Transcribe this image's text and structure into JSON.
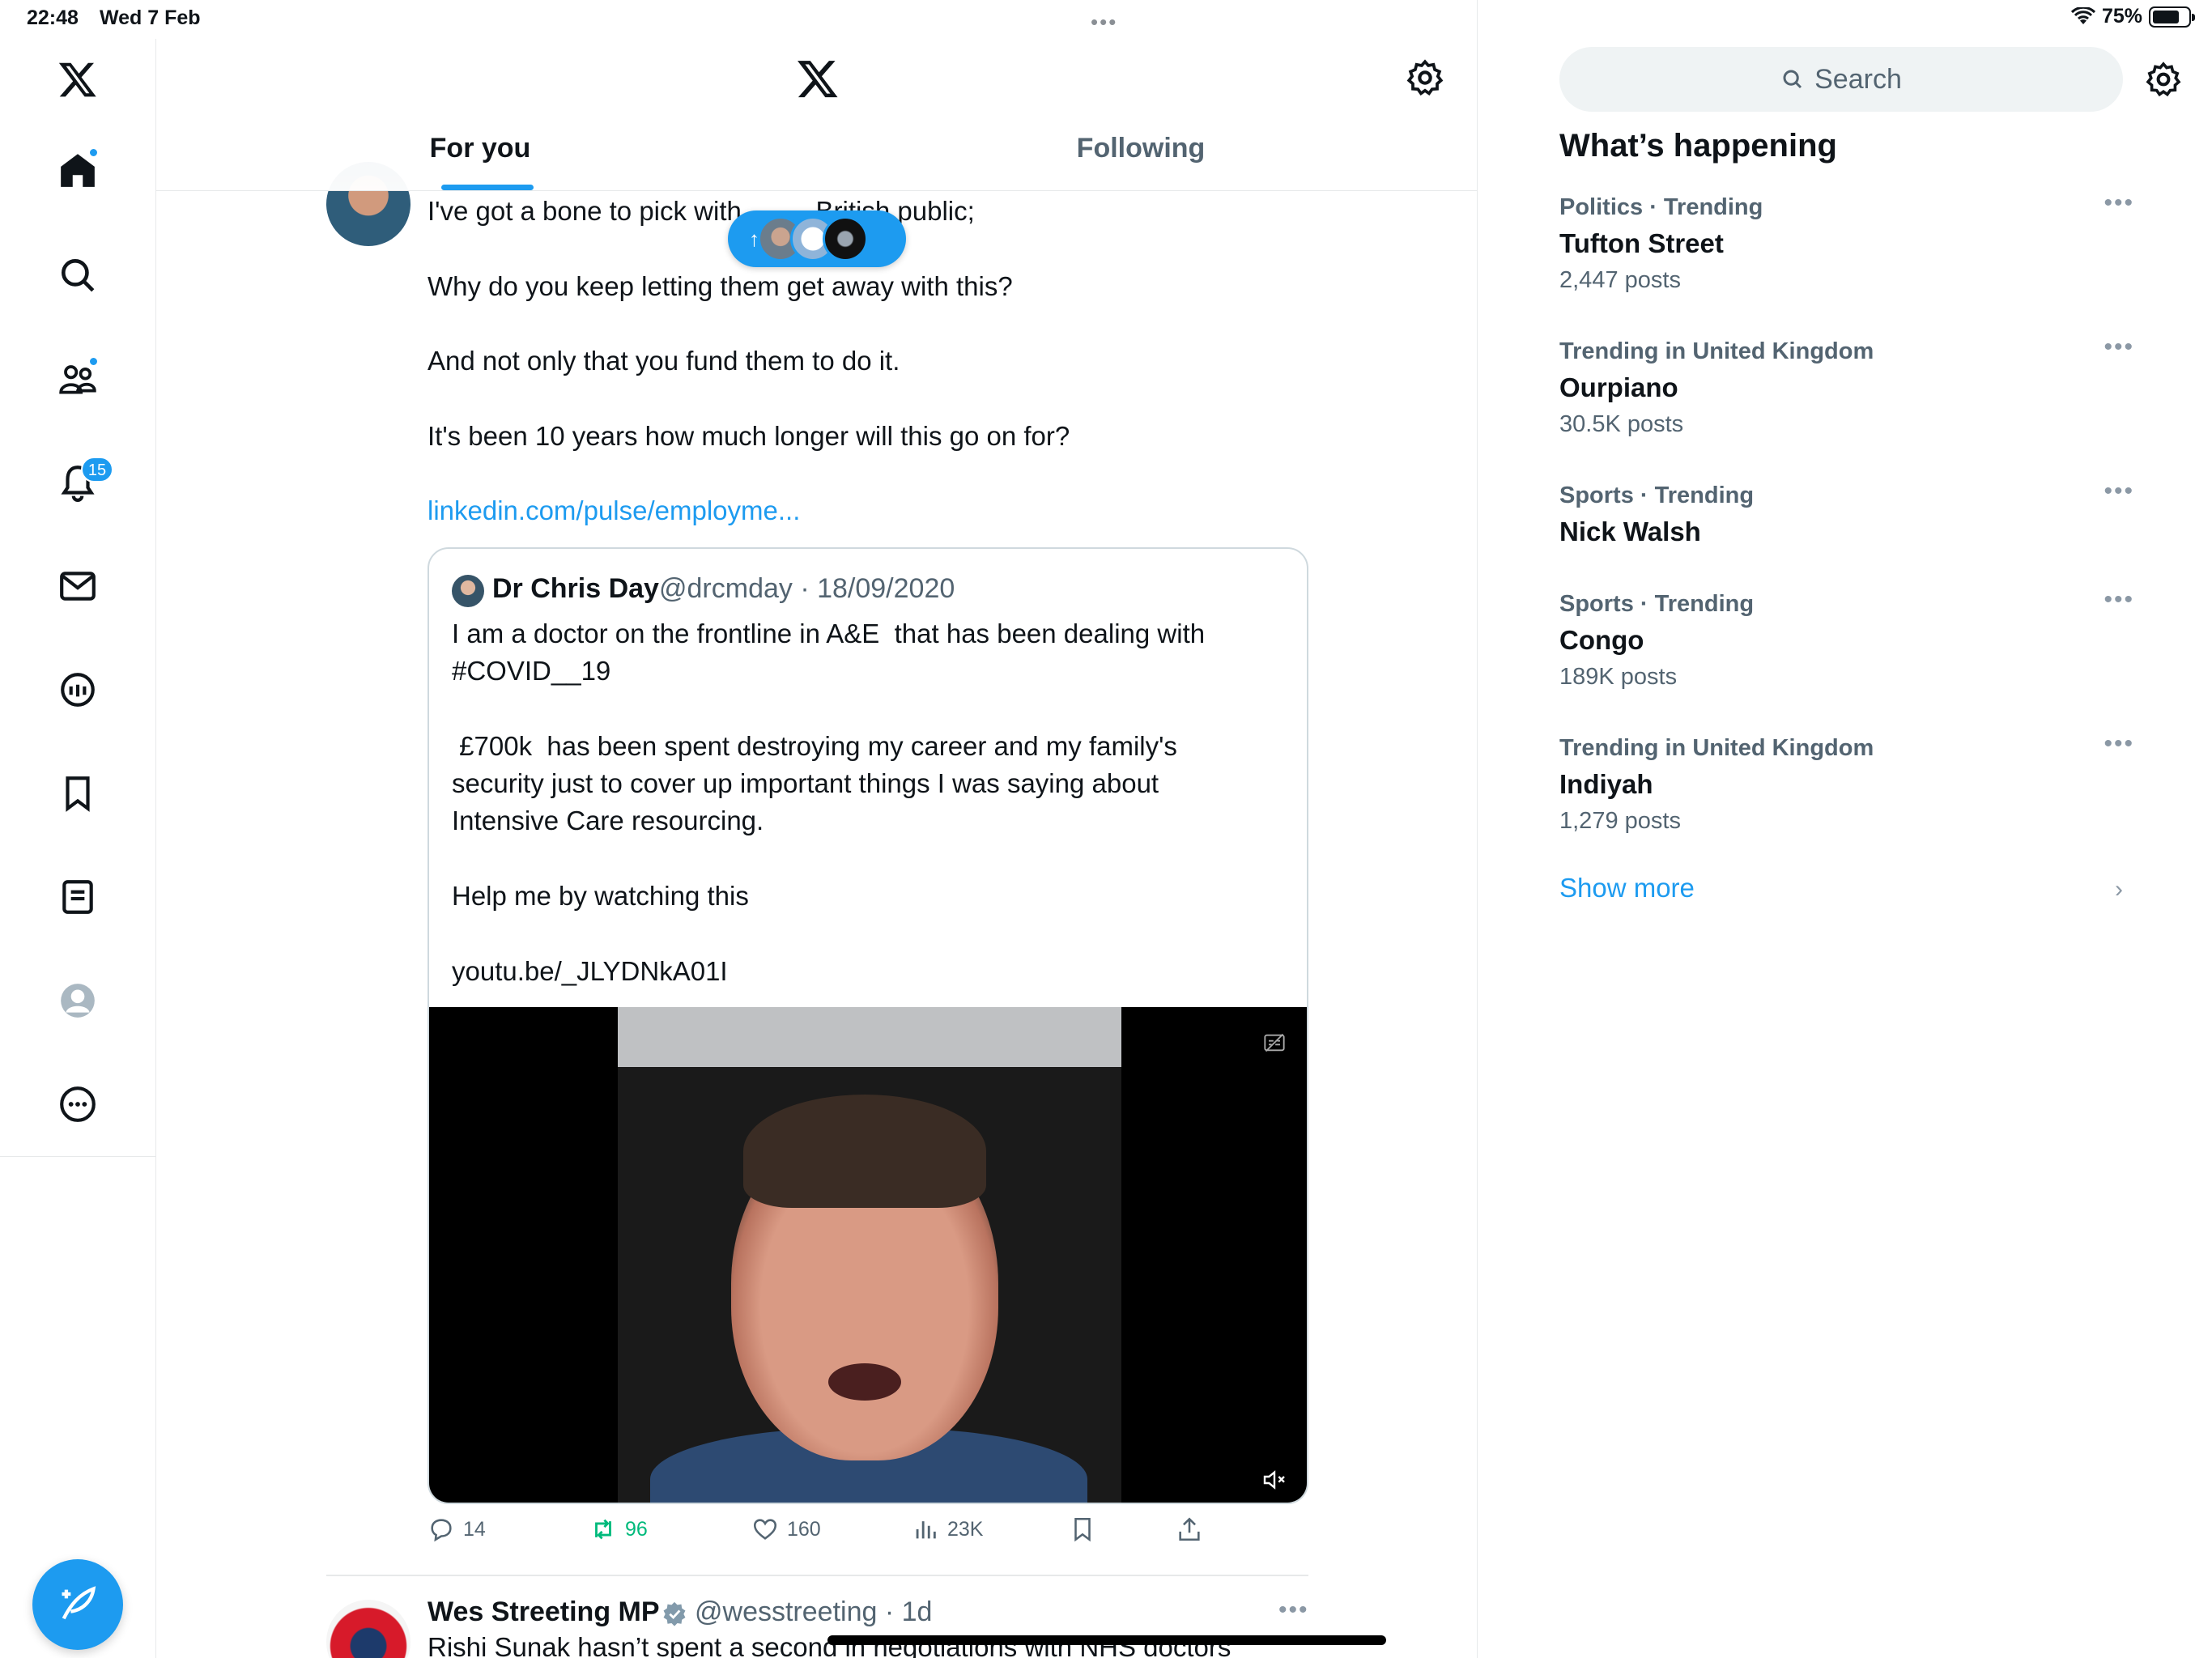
{
  "status_bar": {
    "time": "22:48",
    "date": "Wed 7 Feb",
    "dots": "•••",
    "battery": "75%"
  },
  "header": {
    "tabs": [
      {
        "label": "For you"
      },
      {
        "label": "Following"
      }
    ]
  },
  "left_nav": {
    "notifications_badge": "15",
    "icons": [
      "x-logo-icon",
      "home-icon",
      "search-icon",
      "communities-icon",
      "notifications-icon",
      "messages-icon",
      "grok-icon",
      "bookmarks-icon",
      "lists-icon",
      "profile-icon",
      "more-icon",
      "compose-icon"
    ]
  },
  "new_posts_pill": {
    "arrow": "↑"
  },
  "tweet": {
    "lines": [
      "I've got a bone to pick with          British public;",
      "Why do you keep letting them get away with this?",
      "And not only that you fund them to do it.",
      "It's been 10 years how much longer will this go on for?"
    ],
    "link": "linkedin.com/pulse/employme...",
    "quote": {
      "name": "Dr Chris Day",
      "handle_date": "@drcmday · 18/09/2020",
      "lines": [
        "I am a doctor on the frontline in A&E  that has been dealing with",
        "#COVID__19",
        " £700k  has been spent destroying my career and my family's",
        "security just to cover up important things I was saying about",
        "Intensive Care resourcing.",
        "Help me by watching this",
        "youtu.be/_JLYDNkA01I"
      ]
    },
    "actions": {
      "replies": "14",
      "retweets": "96",
      "likes": "160",
      "views": "23K"
    }
  },
  "next_tweet": {
    "name": "Wes Streeting MP",
    "handle_date": "@wesstreeting · 1d",
    "text": "Rishi Sunak hasn’t spent a second in negotiations with NHS doctors",
    "more": "•••"
  },
  "right": {
    "search_placeholder": "Search",
    "section_title": "What’s happening",
    "trends": [
      {
        "meta": "Politics · Trending",
        "title": "Tufton Street",
        "count": "2,447 posts"
      },
      {
        "meta": "Trending in United Kingdom",
        "title": "Ourpiano",
        "count": "30.5K posts"
      },
      {
        "meta": "Sports · Trending",
        "title": "Nick Walsh",
        "count": ""
      },
      {
        "meta": "Sports · Trending",
        "title": "Congo",
        "count": "189K posts"
      },
      {
        "meta": "Trending in United Kingdom",
        "title": "Indiyah",
        "count": "1,279 posts"
      }
    ],
    "trend_more": "•••",
    "show_more": "Show more",
    "show_more_chevron": "›"
  },
  "colors": {
    "accent": "#1d9bf0",
    "retweet": "#00ba7c",
    "secondary_text": "#536471",
    "border": "#e7e9ea"
  }
}
